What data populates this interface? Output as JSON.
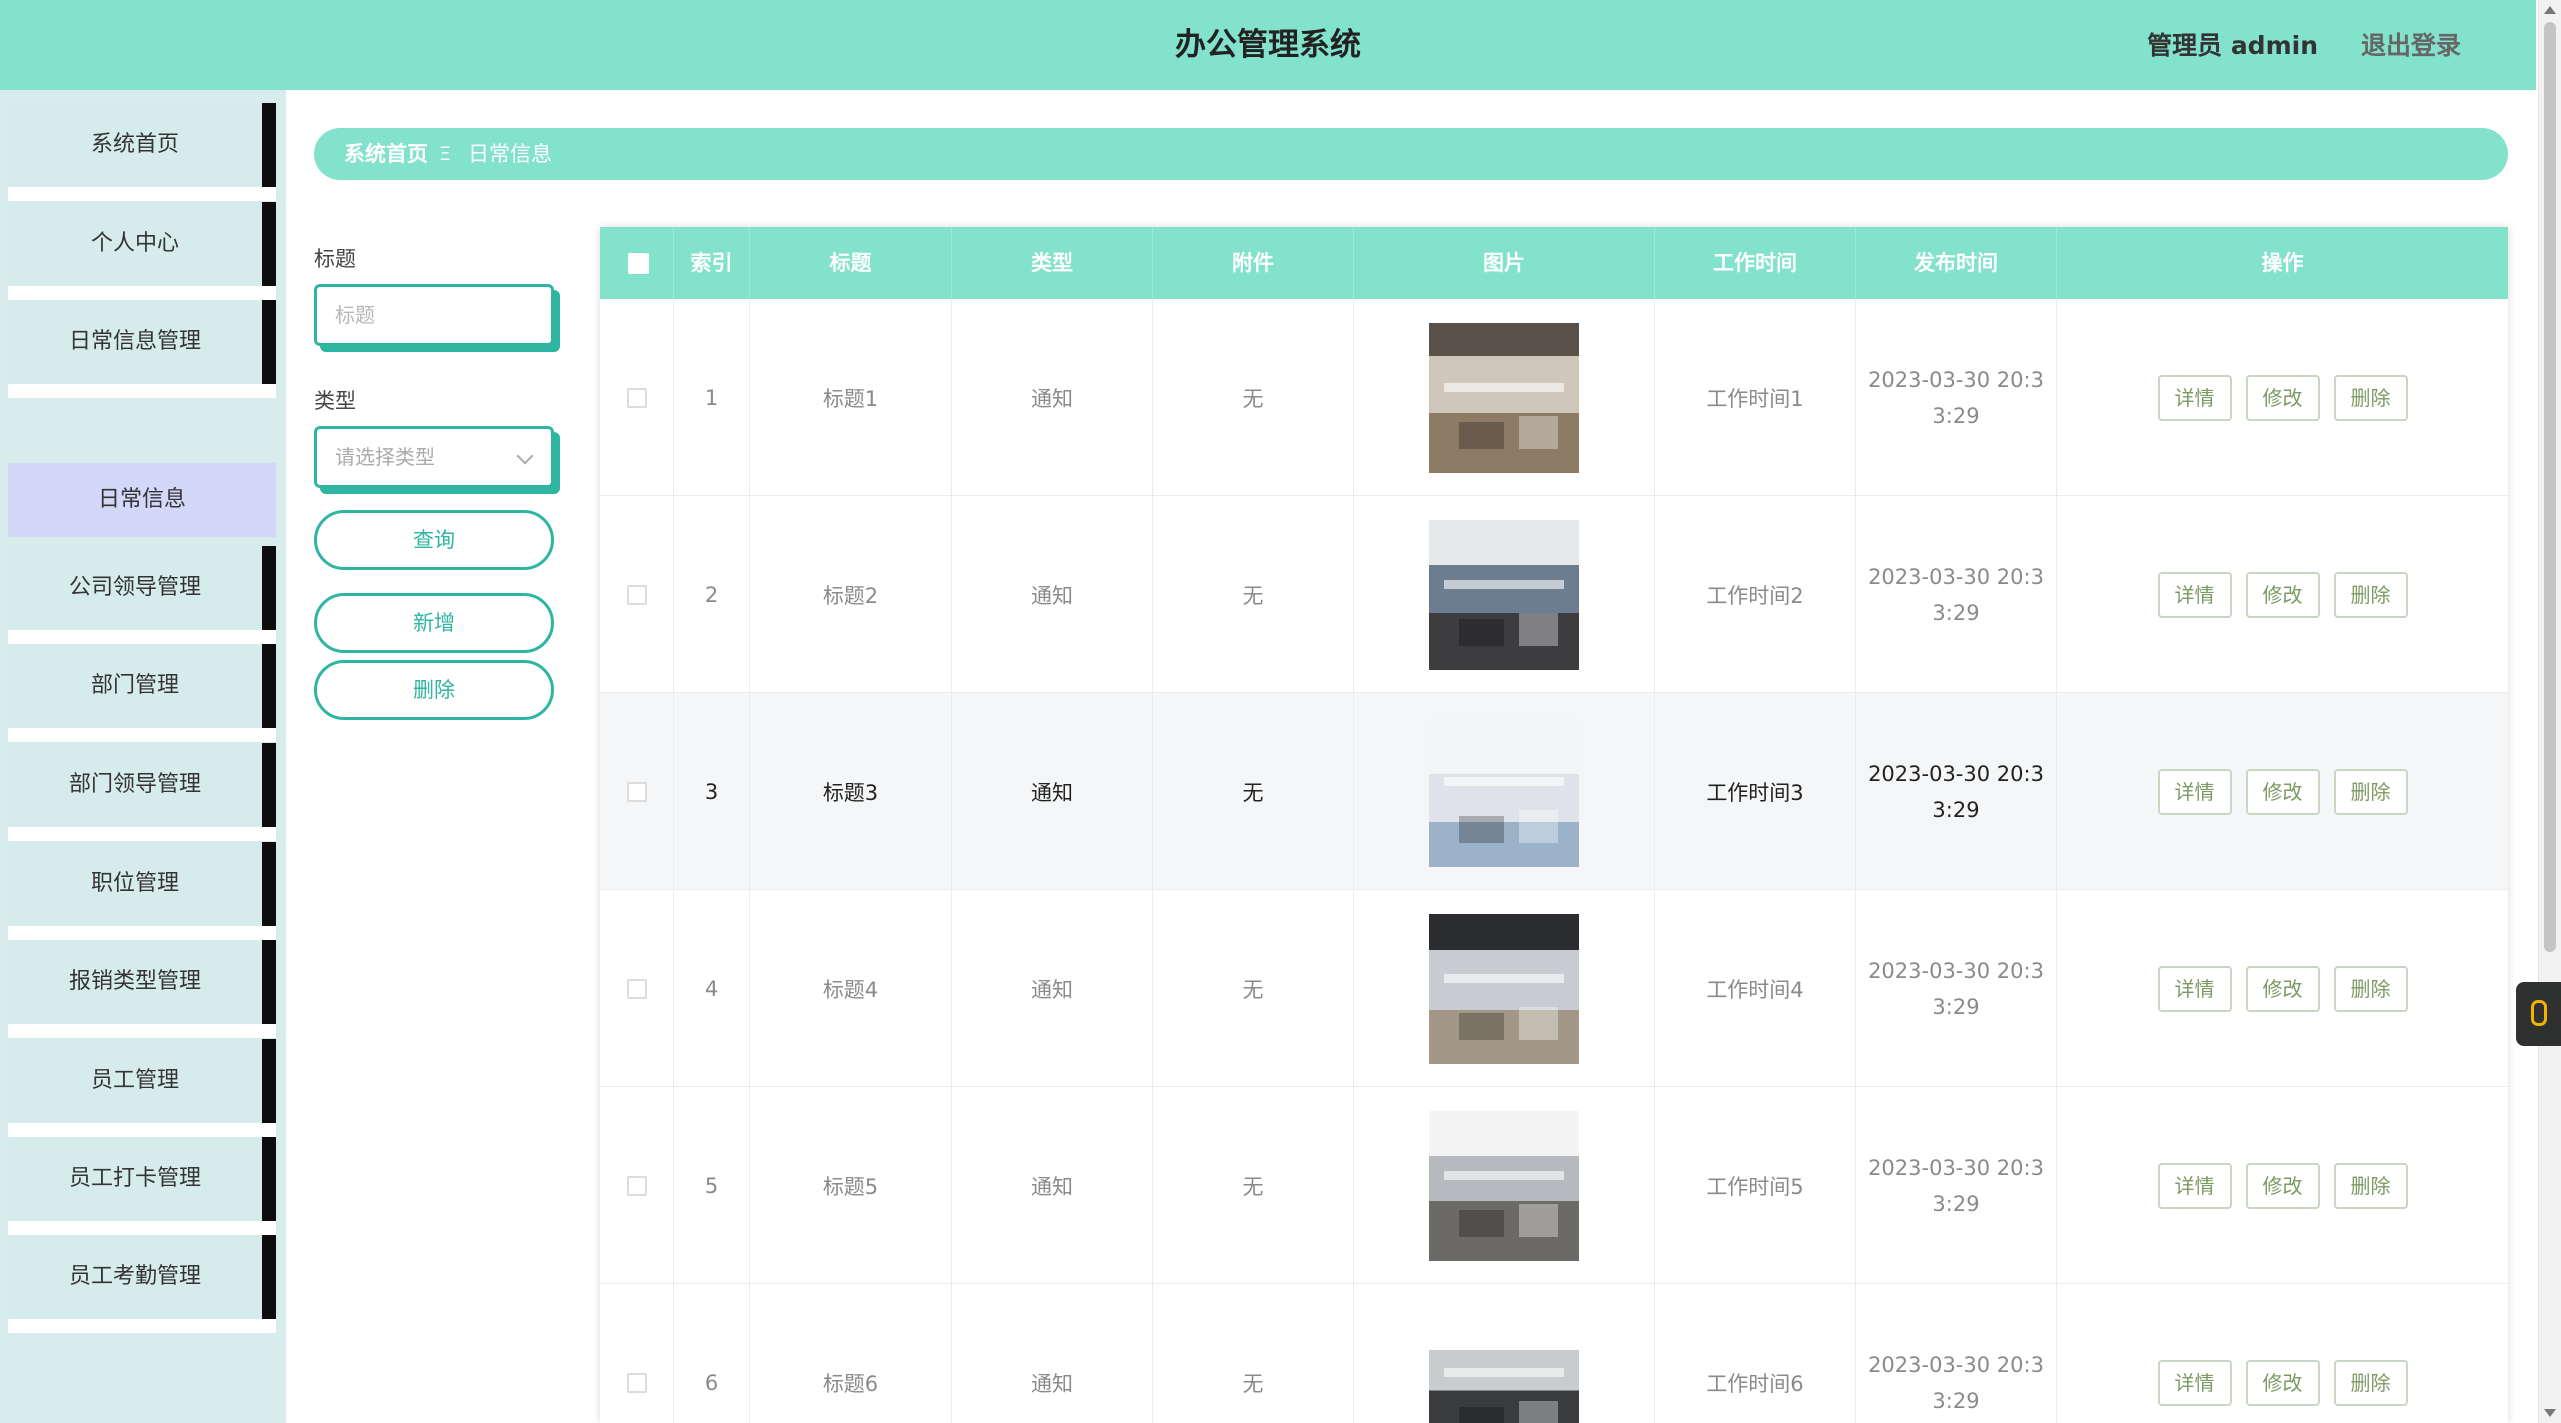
{
  "header": {
    "title": "办公管理系统",
    "user": "管理员 admin",
    "logout": "退出登录"
  },
  "sidebar": {
    "items": [
      {
        "label": "系统首页"
      },
      {
        "label": "个人中心"
      },
      {
        "label": "日常信息管理"
      },
      {
        "label": "公司领导管理"
      },
      {
        "label": "部门管理"
      },
      {
        "label": "部门领导管理"
      },
      {
        "label": "职位管理"
      },
      {
        "label": "报销类型管理"
      },
      {
        "label": "员工管理"
      },
      {
        "label": "员工打卡管理"
      },
      {
        "label": "员工考勤管理"
      }
    ],
    "active_sub": "日常信息"
  },
  "breadcrumb": {
    "home": "系统首页",
    "separator": "Ξ",
    "current": "日常信息"
  },
  "filters": {
    "title_label": "标题",
    "title_placeholder": "标题",
    "type_label": "类型",
    "type_placeholder": "请选择类型",
    "query_button": "查询",
    "add_button": "新增",
    "delete_button": "删除"
  },
  "table": {
    "columns": [
      "索引",
      "标题",
      "类型",
      "附件",
      "图片",
      "工作时间",
      "发布时间",
      "操作"
    ],
    "action_labels": {
      "detail": "详情",
      "edit": "修改",
      "delete": "删除"
    },
    "rows": [
      {
        "index": "1",
        "title": "标题1",
        "type": "通知",
        "attachment": "无",
        "image": "office-reception-photo",
        "work_time": "工作时间1",
        "publish_time_a": "2023-03-30 20:3",
        "publish_time_b": "3:29"
      },
      {
        "index": "2",
        "title": "标题2",
        "type": "通知",
        "attachment": "无",
        "image": "open-office-corridor-photo",
        "work_time": "工作时间2",
        "publish_time_a": "2023-03-30 20:3",
        "publish_time_b": "3:29"
      },
      {
        "index": "3",
        "title": "标题3",
        "type": "通知",
        "attachment": "无",
        "image": "lounge-area-photo",
        "work_time": "工作时间3",
        "publish_time_a": "2023-03-30 20:3",
        "publish_time_b": "3:29"
      },
      {
        "index": "4",
        "title": "标题4",
        "type": "通知",
        "attachment": "无",
        "image": "workstation-office-photo",
        "work_time": "工作时间4",
        "publish_time_a": "2023-03-30 20:3",
        "publish_time_b": "3:29"
      },
      {
        "index": "5",
        "title": "标题5",
        "type": "通知",
        "attachment": "无",
        "image": "desk-cluster-photo",
        "work_time": "工作时间5",
        "publish_time_a": "2023-03-30 20:3",
        "publish_time_b": "3:29"
      },
      {
        "index": "6",
        "title": "标题6",
        "type": "通知",
        "attachment": "无",
        "image": "cubicle-office-photo",
        "work_time": "工作时间6",
        "publish_time_a": "2023-03-30 20:3",
        "publish_time_b": "3:29"
      }
    ],
    "highlight_row": 2
  },
  "colors": {
    "accent": "#82e2cb",
    "accent_dark": "#2fb6a3",
    "sidebar_bg": "#d9ecec",
    "sidebar_active": "#d3d7f8",
    "action_text": "#7c9a63"
  }
}
